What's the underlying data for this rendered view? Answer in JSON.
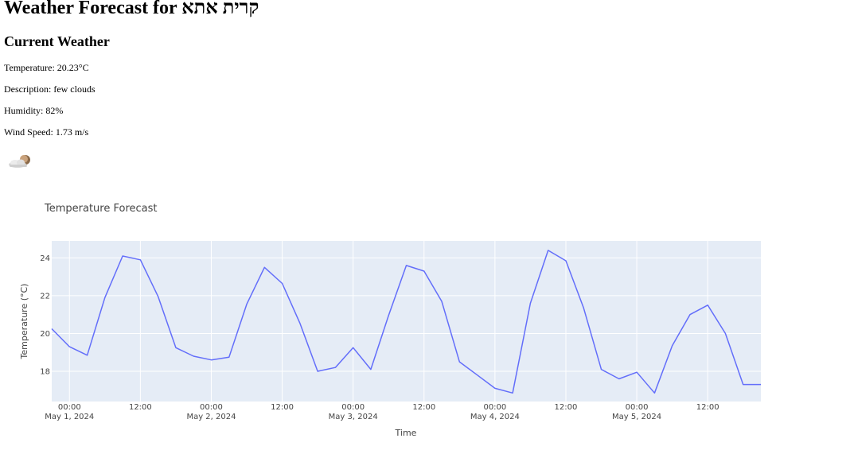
{
  "page": {
    "title": "Weather Forecast for קרית אתא"
  },
  "current": {
    "heading": "Current Weather",
    "temperature": "Temperature: 20.23°C",
    "description": "Description: few clouds",
    "humidity": "Humidity: 82%",
    "wind": "Wind Speed: 1.73 m/s",
    "icon": "few-clouds-night-icon"
  },
  "chart_data": {
    "type": "line",
    "title": "Temperature Forecast",
    "xlabel": "Time",
    "ylabel": "Temperature (°C)",
    "grid": true,
    "legend": "none",
    "color": "#636efa",
    "plot_bg": "#e5ecf6",
    "ylim": [
      16.4,
      24.9
    ],
    "yticks": [
      18,
      20,
      22,
      24
    ],
    "xlim": [
      "2024-04-30 21:00",
      "2024-05-05 21:00"
    ],
    "xticks": [
      {
        "at": "2024-05-01 00:00",
        "label": "00:00",
        "sublabel": "May 1, 2024"
      },
      {
        "at": "2024-05-01 12:00",
        "label": "12:00",
        "sublabel": ""
      },
      {
        "at": "2024-05-02 00:00",
        "label": "00:00",
        "sublabel": "May 2, 2024"
      },
      {
        "at": "2024-05-02 12:00",
        "label": "12:00",
        "sublabel": ""
      },
      {
        "at": "2024-05-03 00:00",
        "label": "00:00",
        "sublabel": "May 3, 2024"
      },
      {
        "at": "2024-05-03 12:00",
        "label": "12:00",
        "sublabel": ""
      },
      {
        "at": "2024-05-04 00:00",
        "label": "00:00",
        "sublabel": "May 4, 2024"
      },
      {
        "at": "2024-05-04 12:00",
        "label": "12:00",
        "sublabel": ""
      },
      {
        "at": "2024-05-05 00:00",
        "label": "00:00",
        "sublabel": "May 5, 2024"
      },
      {
        "at": "2024-05-05 12:00",
        "label": "12:00",
        "sublabel": ""
      }
    ],
    "x": [
      "2024-04-30 21:00",
      "2024-05-01 00:00",
      "2024-05-01 03:00",
      "2024-05-01 06:00",
      "2024-05-01 09:00",
      "2024-05-01 12:00",
      "2024-05-01 15:00",
      "2024-05-01 18:00",
      "2024-05-01 21:00",
      "2024-05-02 00:00",
      "2024-05-02 03:00",
      "2024-05-02 06:00",
      "2024-05-02 09:00",
      "2024-05-02 12:00",
      "2024-05-02 15:00",
      "2024-05-02 18:00",
      "2024-05-02 21:00",
      "2024-05-03 00:00",
      "2024-05-03 03:00",
      "2024-05-03 06:00",
      "2024-05-03 09:00",
      "2024-05-03 12:00",
      "2024-05-03 15:00",
      "2024-05-03 18:00",
      "2024-05-03 21:00",
      "2024-05-04 00:00",
      "2024-05-04 03:00",
      "2024-05-04 06:00",
      "2024-05-04 09:00",
      "2024-05-04 12:00",
      "2024-05-04 15:00",
      "2024-05-04 18:00",
      "2024-05-04 21:00",
      "2024-05-05 00:00",
      "2024-05-05 03:00",
      "2024-05-05 06:00",
      "2024-05-05 09:00",
      "2024-05-05 12:00",
      "2024-05-05 15:00",
      "2024-05-05 18:00",
      "2024-05-05 21:00"
    ],
    "y": [
      20.25,
      19.3,
      18.85,
      21.9,
      24.1,
      23.9,
      21.95,
      19.25,
      18.8,
      18.6,
      18.75,
      21.55,
      23.5,
      22.65,
      20.55,
      18.0,
      18.2,
      19.25,
      18.1,
      20.95,
      23.6,
      23.3,
      21.7,
      18.5,
      17.8,
      17.1,
      16.85,
      21.6,
      24.4,
      23.85,
      21.35,
      18.1,
      17.6,
      17.95,
      16.85,
      19.35,
      21.0,
      21.5,
      20.0,
      17.3,
      17.3
    ]
  }
}
